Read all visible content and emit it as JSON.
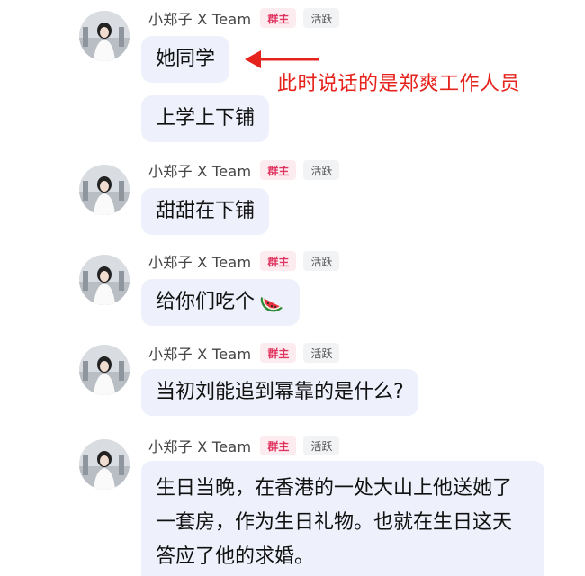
{
  "sender": {
    "name": "小郑子 X Team",
    "role_badge": "群主",
    "activity_badge": "活跃"
  },
  "messages": [
    {
      "bubbles": [
        "她同学",
        "上学上下铺"
      ]
    },
    {
      "bubbles": [
        "甜甜在下铺"
      ]
    },
    {
      "bubbles": [
        "给你们吃个"
      ],
      "emoji": "watermelon-icon"
    },
    {
      "bubbles": [
        "当初刘能追到幂靠的是什么?"
      ]
    },
    {
      "bubbles": [
        "生日当晚，在香港的一处大山上他送她了一套房，作为生日礼物。也就在生日这天答应了他的求婚。"
      ]
    }
  ],
  "annotation": {
    "text": "此时说话的是郑爽工作人员",
    "color": "#e5231c"
  },
  "colors": {
    "bubble_bg": "#eef1fb",
    "owner_badge_bg": "#fdecef",
    "owner_badge_text": "#e03560",
    "active_badge_bg": "#f2f3f5"
  }
}
